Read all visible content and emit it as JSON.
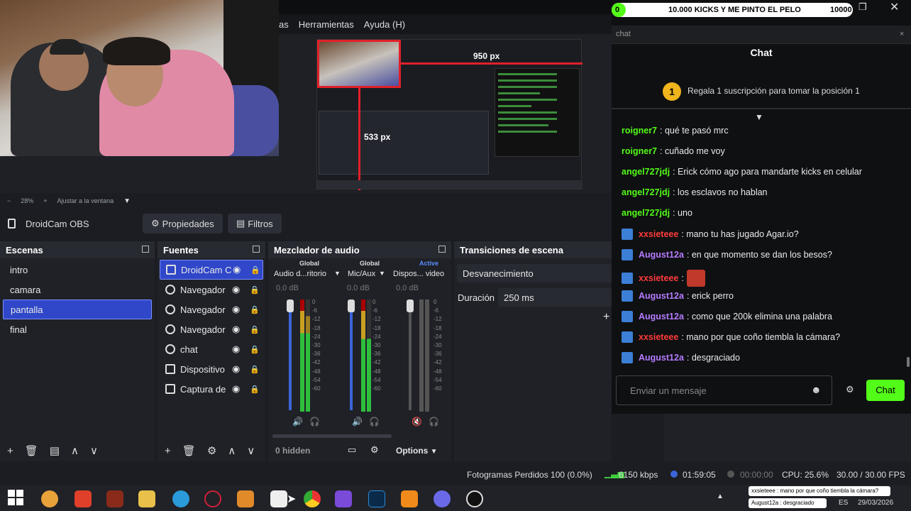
{
  "menu": {
    "items": [
      "as",
      "Herramientas",
      "Ayuda (H)"
    ]
  },
  "preview": {
    "label_width": "950 px",
    "label_height": "533 px"
  },
  "zoom": {
    "minus": "−",
    "level": "28%",
    "plus": "+",
    "fit": "Ajustar a la ventana"
  },
  "source_bar": {
    "name": "DroidCam OBS",
    "properties": "Propiedades",
    "filters": "Filtros"
  },
  "scenes": {
    "title": "Escenas",
    "items": [
      "intro",
      "camara",
      "pantalla",
      "final"
    ],
    "selected_index": 2
  },
  "sources": {
    "title": "Fuentes",
    "items": [
      "DroidCam C",
      "Navegador",
      "Navegador",
      "Navegador",
      "chat",
      "Dispositivo",
      "Captura de"
    ]
  },
  "mixer": {
    "title": "Mezclador de audio",
    "channels": [
      {
        "tag": "Global",
        "name": "Audio d...ritorio",
        "db": "0.0 dB"
      },
      {
        "tag": "Global",
        "name": "Mic/Aux",
        "db": "0.0 dB"
      },
      {
        "tag": "Active",
        "name": "Dispos... video",
        "db": "0.0 dB"
      }
    ],
    "scale": [
      "0",
      "-6",
      "-12",
      "-18",
      "-24",
      "-30",
      "-36",
      "-42",
      "-48",
      "-54",
      "-60"
    ],
    "hidden": "0 hidden",
    "options": "Options"
  },
  "transitions": {
    "title": "Transiciones de escena",
    "type": "Desvanecimiento",
    "duration_label": "Duración",
    "duration_value": "250 ms"
  },
  "status": {
    "dropped": "Fotogramas Perdidos 100 (0.0%)",
    "bitrate": "6150 kbps",
    "live_time": "01:59:05",
    "rec_time": "00:00:00",
    "cpu": "CPU: 25.6%",
    "fps": "30.00 / 30.00 FPS"
  },
  "kick_goal": {
    "start": "0",
    "label": "10.000 KICKS Y ME PINTO EL PELO",
    "end": "10000",
    "progress": 0.02
  },
  "chat": {
    "tab": "chat",
    "title": "Chat",
    "gift_rank": "1",
    "gift_text": "Regala 1 suscripción para tomar la posición 1",
    "messages": [
      {
        "user": "roigner7",
        "text": ": qué te pasó mrc",
        "color": "#53fc18"
      },
      {
        "user": "roigner7",
        "text": ": cuñado me voy",
        "color": "#53fc18"
      },
      {
        "user": "angel727jdj",
        "text": ": Erick cómo ago para mandarte kicks en celular",
        "color": "#53fc18"
      },
      {
        "user": "angel727jdj",
        "text": ": los esclavos no hablan",
        "color": "#53fc18"
      },
      {
        "user": "angel727jdj",
        "text": ": uno",
        "color": "#53fc18"
      },
      {
        "user": "xxsieteee",
        "text": ": mano tu has jugado Agar.io?",
        "color": "#ff3b3b"
      },
      {
        "user": "August12a",
        "text": ": en que momento se dan los besos?",
        "color": "#b57bff"
      },
      {
        "user": "xxsieteee",
        "text": ":",
        "color": "#ff3b3b"
      },
      {
        "user": "August12a",
        "text": ": erick perro",
        "color": "#b57bff"
      },
      {
        "user": "August12a",
        "text": ": como que 200k elimina una palabra",
        "color": "#b57bff"
      },
      {
        "user": "xxsieteee",
        "text": ": mano por que coño tiembla la cámara?",
        "color": "#ff3b3b"
      },
      {
        "user": "August12a",
        "text": ": desgraciado",
        "color": "#b57bff"
      }
    ],
    "input_placeholder": "Enviar un mensaje",
    "send": "Chat",
    "accent": "#53fc18"
  },
  "taskbar": {
    "lang": "ES",
    "date": "29/03/2026",
    "notif1": "xxsieteee : mano por que coño tiembla la cámara?",
    "notif2": "August12a : desgraciado"
  }
}
